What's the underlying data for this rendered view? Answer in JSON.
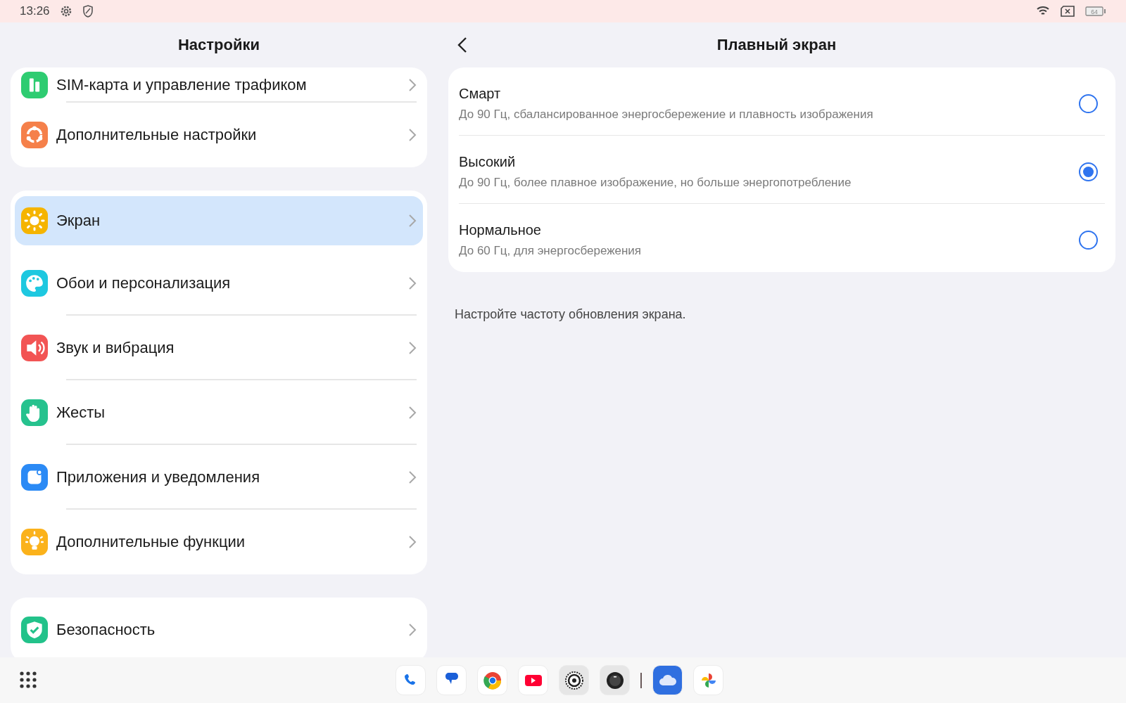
{
  "status_bar": {
    "time": "13:26",
    "battery": "64"
  },
  "settings": {
    "title": "Настройки",
    "groups": [
      {
        "items": [
          {
            "label": "SIM-карта и управление трафиком",
            "kind": "sim",
            "selected": false
          },
          {
            "label": "Дополнительные настройки",
            "kind": "more",
            "selected": false
          }
        ]
      },
      {
        "items": [
          {
            "label": "Экран",
            "kind": "display",
            "selected": true
          },
          {
            "label": "Обои и персонализация",
            "kind": "palette",
            "selected": false
          },
          {
            "label": "Звук и вибрация",
            "kind": "sound",
            "selected": false
          },
          {
            "label": "Жесты",
            "kind": "gesture",
            "selected": false
          },
          {
            "label": "Приложения и уведомления",
            "kind": "apps",
            "selected": false
          },
          {
            "label": "Дополнительные функции",
            "kind": "bulb",
            "selected": false
          }
        ]
      },
      {
        "items": [
          {
            "label": "Безопасность",
            "kind": "security",
            "selected": false
          }
        ]
      }
    ]
  },
  "detail": {
    "title": "Плавный экран",
    "options": [
      {
        "title": "Смарт",
        "description": "До 90 Гц, сбалансированное энергосбережение и плавность изображения",
        "selected": false
      },
      {
        "title": "Высокий",
        "description": "До 90 Гц, более плавное изображение, но больше энергопотребление",
        "selected": true
      },
      {
        "title": "Нормальное",
        "description": "До 60 Гц, для энергосбережения",
        "selected": false
      }
    ],
    "footnote": "Настройте частоту обновления экрана."
  },
  "dock": {
    "apps": [
      {
        "kind": "phone"
      },
      {
        "kind": "messages"
      },
      {
        "kind": "browser"
      },
      {
        "kind": "video"
      },
      {
        "kind": "settings"
      },
      {
        "kind": "camera"
      },
      {
        "kind": "divider"
      },
      {
        "kind": "cloud"
      },
      {
        "kind": "photos"
      }
    ]
  }
}
